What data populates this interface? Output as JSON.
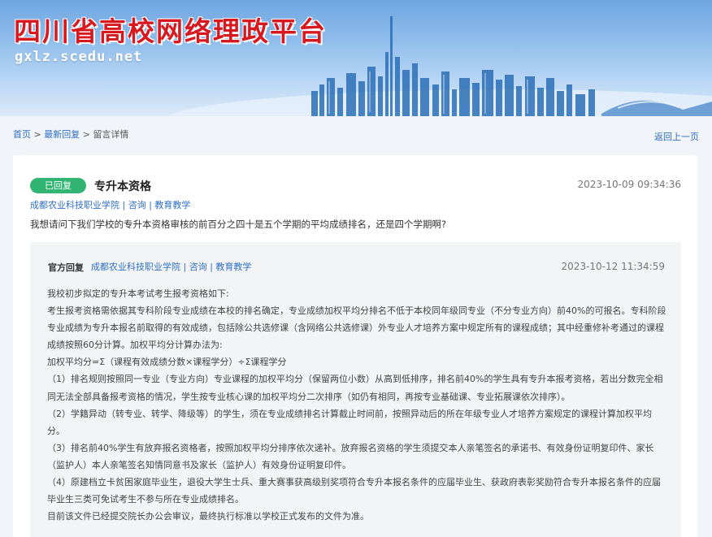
{
  "banner": {
    "title": "四川省高校网络理政平台",
    "url": "gxlz.scedu.net"
  },
  "breadcrumb": {
    "home": "首页",
    "sep1": " > ",
    "latest": "最新回复",
    "sep2": " > ",
    "current": "留言详情"
  },
  "back_link": "返回上一页",
  "question": {
    "status": "已回复",
    "title": "专升本资格",
    "date": "2023-10-09 09:34:36",
    "meta": "成都农业科技职业学院 | 咨询 | 教育教学",
    "body": "我想请问下我们学校的专升本资格审核的前百分之四十是五个学期的平均成绩排名，还是四个学期啊?"
  },
  "reply": {
    "label": "官方回复",
    "meta": "成都农业科技职业学院 | 咨询 | 教育教学",
    "date": "2023-10-12 11:34:59",
    "paragraphs": [
      "我校初步拟定的专升本考试考生报考资格如下:",
      "考生报考资格需依据其专科阶段专业成绩在本校的排名确定，专业成绩加权平均分排名不低于本校同年级同专业（不分专业方向）前40%的可报名。专科阶段专业成绩为专升本报名前取得的有效成绩，包括除公共选修课（含网络公共选修课）外专业人才培养方案中规定所有的课程成绩；其中经重修补考通过的课程成绩按照60分计算。加权平均分计算办法为:",
      "加权平均分=Σ（课程有效成绩分数×课程学分）÷Σ课程学分",
      "（1）排名规则按照同一专业（专业方向）专业课程的加权平均分（保留两位小数）从高到低排序，排名前40%的学生具有专升本报考资格，若出分数完全相同无法全部具备报考资格的情况，学生按专业核心课的加权平均分二次排序（如仍有相同，再按专业基础课、专业拓展课依次排序）。",
      "（2）学籍异动（转专业、转学、降级等）的学生，须在专业成绩排名计算截止时间前，按照异动后的所在年级专业人才培养方案规定的课程计算加权平均分。",
      "（3）排名前40%学生有放弃报名资格者，按照加权平均分排序依次递补。放弃报名资格的学生须提交本人亲笔签名的承诺书、有效身份证明复印件、家长（监护人）本人亲笔签名知情同意书及家长（监护人）有效身份证明复印件。",
      "（4）原建档立卡贫困家庭毕业生，退役大学生士兵、重大赛事获高级别奖项符合专升本报名条件的应届毕业生、获政府表彰奖励符合专升本报名条件的应届毕业生三类可免试考生不参与所在专业成绩排名。",
      "目前该文件已经提交院长办公会审议，最终执行标准以学校正式发布的文件为准。"
    ]
  },
  "colors": {
    "banner_title": "#d7191f",
    "badge": "#32b473",
    "link": "#2f6fc4"
  }
}
